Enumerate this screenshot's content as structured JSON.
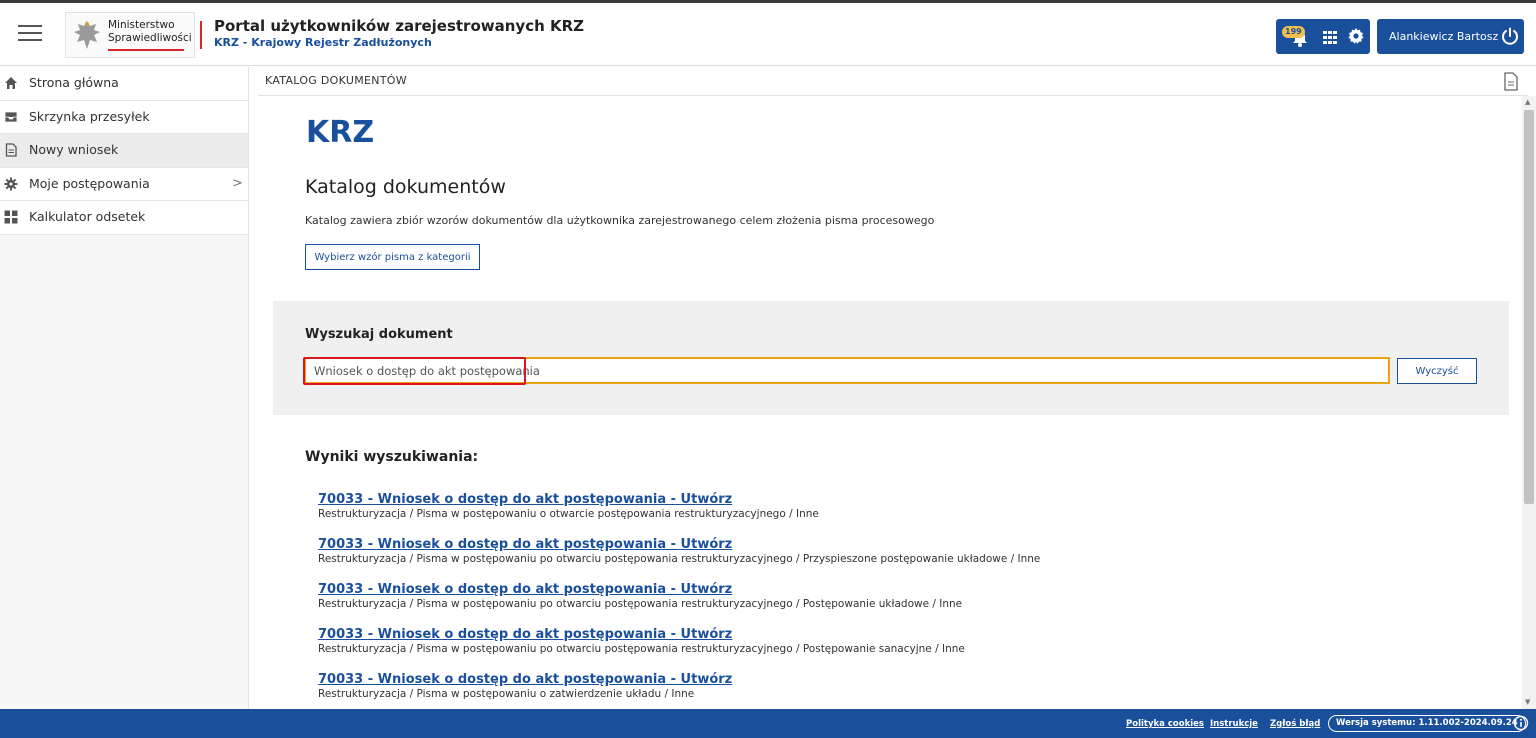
{
  "header": {
    "logo_line1": "Ministerstwo",
    "logo_line2": "Sprawiedliwości",
    "title": "Portal użytkowników zarejestrowanych KRZ",
    "subtitle": "KRZ - Krajowy Rejestr Zadłużonych",
    "notifications_count": "199",
    "user_name": "Alankiewicz Bartosz"
  },
  "sidebar": {
    "items": [
      {
        "label": "Strona główna",
        "icon": "home-icon"
      },
      {
        "label": "Skrzynka przesyłek",
        "icon": "inbox-icon"
      },
      {
        "label": "Nowy wniosek",
        "icon": "document-icon",
        "active": true
      },
      {
        "label": "Moje postępowania",
        "icon": "cog-icon",
        "has_submenu": true
      },
      {
        "label": "Kalkulator odsetek",
        "icon": "calculator-icon"
      }
    ],
    "chevron": ">"
  },
  "breadcrumb": "KATALOG DOKUMENTÓW",
  "main": {
    "heading": "KRZ",
    "catalog_title": "Katalog dokumentów",
    "catalog_description": "Katalog zawiera zbiór wzorów dokumentów dla użytkownika zarejestrowanego celem złożenia pisma procesowego",
    "choose_button": "Wybierz wzór pisma z kategorii"
  },
  "search": {
    "label": "Wyszukaj dokument",
    "value": "Wniosek o dostęp do akt postępowania",
    "clear_button": "Wyczyść"
  },
  "results": {
    "title": "Wyniki wyszukiwania:",
    "items": [
      {
        "link": "70033 - Wniosek o dostęp do akt postępowania - Utwórz",
        "path": "Restrukturyzacja / Pisma w postępowaniu o otwarcie postępowania restrukturyzacyjnego / Inne"
      },
      {
        "link": "70033 - Wniosek o dostęp do akt postępowania - Utwórz",
        "path": "Restrukturyzacja / Pisma w postępowaniu po otwarciu postępowania restrukturyzacyjnego / Przyspieszone postępowanie układowe / Inne"
      },
      {
        "link": "70033 - Wniosek o dostęp do akt postępowania - Utwórz",
        "path": "Restrukturyzacja / Pisma w postępowaniu po otwarciu postępowania restrukturyzacyjnego / Postępowanie układowe / Inne"
      },
      {
        "link": "70033 - Wniosek o dostęp do akt postępowania - Utwórz",
        "path": "Restrukturyzacja / Pisma w postępowaniu po otwarciu postępowania restrukturyzacyjnego / Postępowanie sanacyjne / Inne"
      },
      {
        "link": "70033 - Wniosek o dostęp do akt postępowania - Utwórz",
        "path": "Restrukturyzacja / Pisma w postępowaniu o zatwierdzenie układu / Inne"
      }
    ]
  },
  "footer": {
    "cookies": "Polityka cookies",
    "instructions": "Instrukcje",
    "report": "Zgłoś błąd",
    "version": "Wersja systemu: 1.11.002-2024.09.24"
  },
  "colors": {
    "brand": "#1a4f9c",
    "accent_red": "#d9262c",
    "search_border": "#e8a317",
    "highlight": "#e0141e",
    "badge": "#f3c04e"
  }
}
